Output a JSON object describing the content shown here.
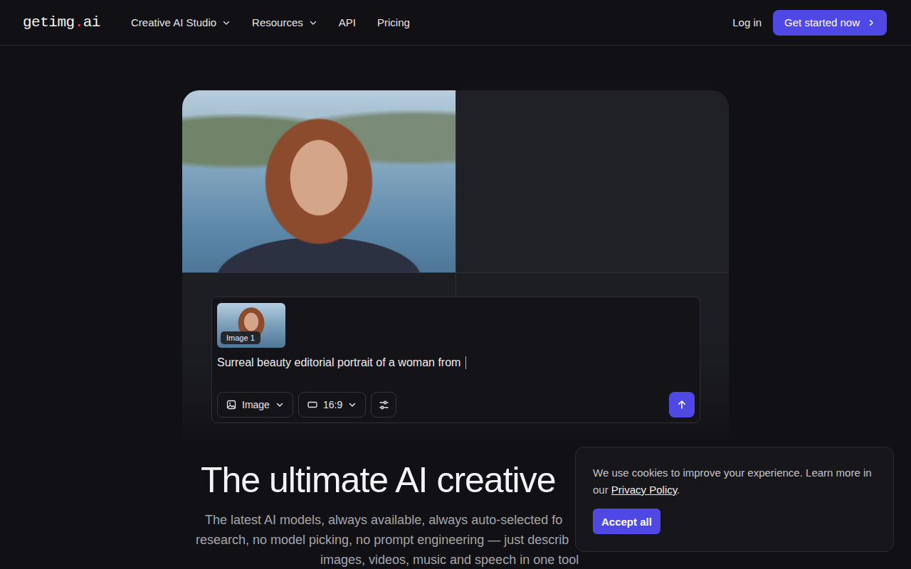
{
  "nav": {
    "logo": [
      "getimg",
      ".",
      "ai"
    ],
    "menu": [
      {
        "label": "Creative AI Studio",
        "has_dropdown": true
      },
      {
        "label": "Resources",
        "has_dropdown": true
      },
      {
        "label": "API",
        "has_dropdown": false
      },
      {
        "label": "Pricing",
        "has_dropdown": false
      }
    ],
    "login": "Log in",
    "cta": "Get started now"
  },
  "hero_card": {
    "attachment_label": "Image 1",
    "prompt": "Surreal beauty editorial portrait of a woman from ",
    "mode": "Image",
    "aspect": "16:9"
  },
  "heading": "The ultimate AI creative",
  "subtitle_lines": [
    "The latest AI models, always available, always auto-selected fo",
    "research, no model picking, no prompt engineering — just describ",
    "images, videos, music and speech in one tool"
  ],
  "cookie": {
    "text": "We use cookies to improve your experience. Learn more in our ",
    "link": "Privacy Policy",
    "end": ".",
    "button": "Accept all"
  }
}
